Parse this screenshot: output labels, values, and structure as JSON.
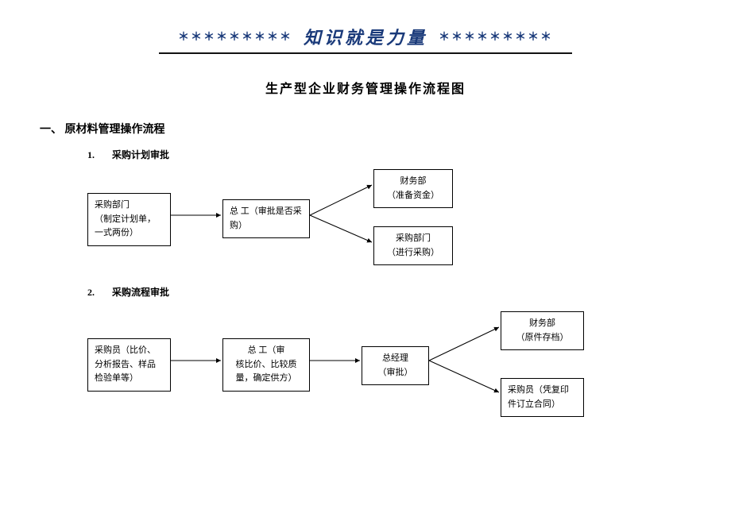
{
  "header": {
    "stars": "＊＊＊＊＊＊＊＊＊",
    "title": "知识就是力量"
  },
  "doc_title": "生产型企业财务管理操作流程图",
  "section1": {
    "number": "一、",
    "title": "原材料管理操作流程"
  },
  "sub1": {
    "number": "1.",
    "title": "采购计划审批"
  },
  "d1": {
    "b1_l1": "采购部门",
    "b1_l2": "（制定计划单，",
    "b1_l3": "一式两份）",
    "b2": "总 工（审批是否采购）",
    "b3_l1": "财务部",
    "b3_l2": "（准备资金）",
    "b4_l1": "采购部门",
    "b4_l2": "（进行采购）"
  },
  "sub2": {
    "number": "2.",
    "title": "采购流程审批"
  },
  "d2": {
    "b1_l1": "采购员（比价、",
    "b1_l2": "分析报告、样品",
    "b1_l3": "检验单等）",
    "b2_l1": "总 工（审",
    "b2_l2": "核比价、比较质",
    "b2_l3": "量，确定供方）",
    "b3_l1": "总经理",
    "b3_l2": "（审批）",
    "b4_l1": "财务部",
    "b4_l2": "（原件存档）",
    "b5_l1": "采购员（凭复印",
    "b5_l2": "件订立合同）"
  }
}
